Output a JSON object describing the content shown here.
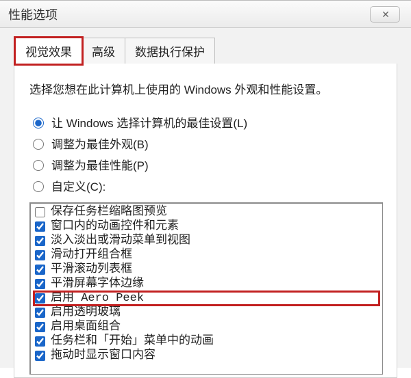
{
  "window": {
    "title": "性能选项",
    "close_glyph": "✕"
  },
  "tabs": [
    {
      "label": "视觉效果",
      "active": true,
      "highlight": true
    },
    {
      "label": "高级",
      "active": false,
      "highlight": false
    },
    {
      "label": "数据执行保护",
      "active": false,
      "highlight": false
    }
  ],
  "description": "选择您想在此计算机上使用的 Windows 外观和性能设置。",
  "radios": [
    {
      "label": "让 Windows 选择计算机的最佳设置(L)",
      "checked": true
    },
    {
      "label": "调整为最佳外观(B)",
      "checked": false
    },
    {
      "label": "调整为最佳性能(P)",
      "checked": false
    },
    {
      "label": "自定义(C):",
      "checked": false
    }
  ],
  "checkboxes": [
    {
      "label": "保存任务栏缩略图预览",
      "checked": false,
      "highlight": false
    },
    {
      "label": "窗口内的动画控件和元素",
      "checked": true,
      "highlight": false
    },
    {
      "label": "淡入淡出或滑动菜单到视图",
      "checked": true,
      "highlight": false
    },
    {
      "label": "滑动打开组合框",
      "checked": true,
      "highlight": false
    },
    {
      "label": "平滑滚动列表框",
      "checked": true,
      "highlight": false
    },
    {
      "label": "平滑屏幕字体边缘",
      "checked": true,
      "highlight": false
    },
    {
      "label": "启用 Aero Peek",
      "checked": true,
      "highlight": true
    },
    {
      "label": "启用透明玻璃",
      "checked": true,
      "highlight": false
    },
    {
      "label": "启用桌面组合",
      "checked": true,
      "highlight": false
    },
    {
      "label": "任务栏和「开始」菜单中的动画",
      "checked": true,
      "highlight": false
    },
    {
      "label": "拖动时显示窗口内容",
      "checked": true,
      "highlight": false
    }
  ]
}
